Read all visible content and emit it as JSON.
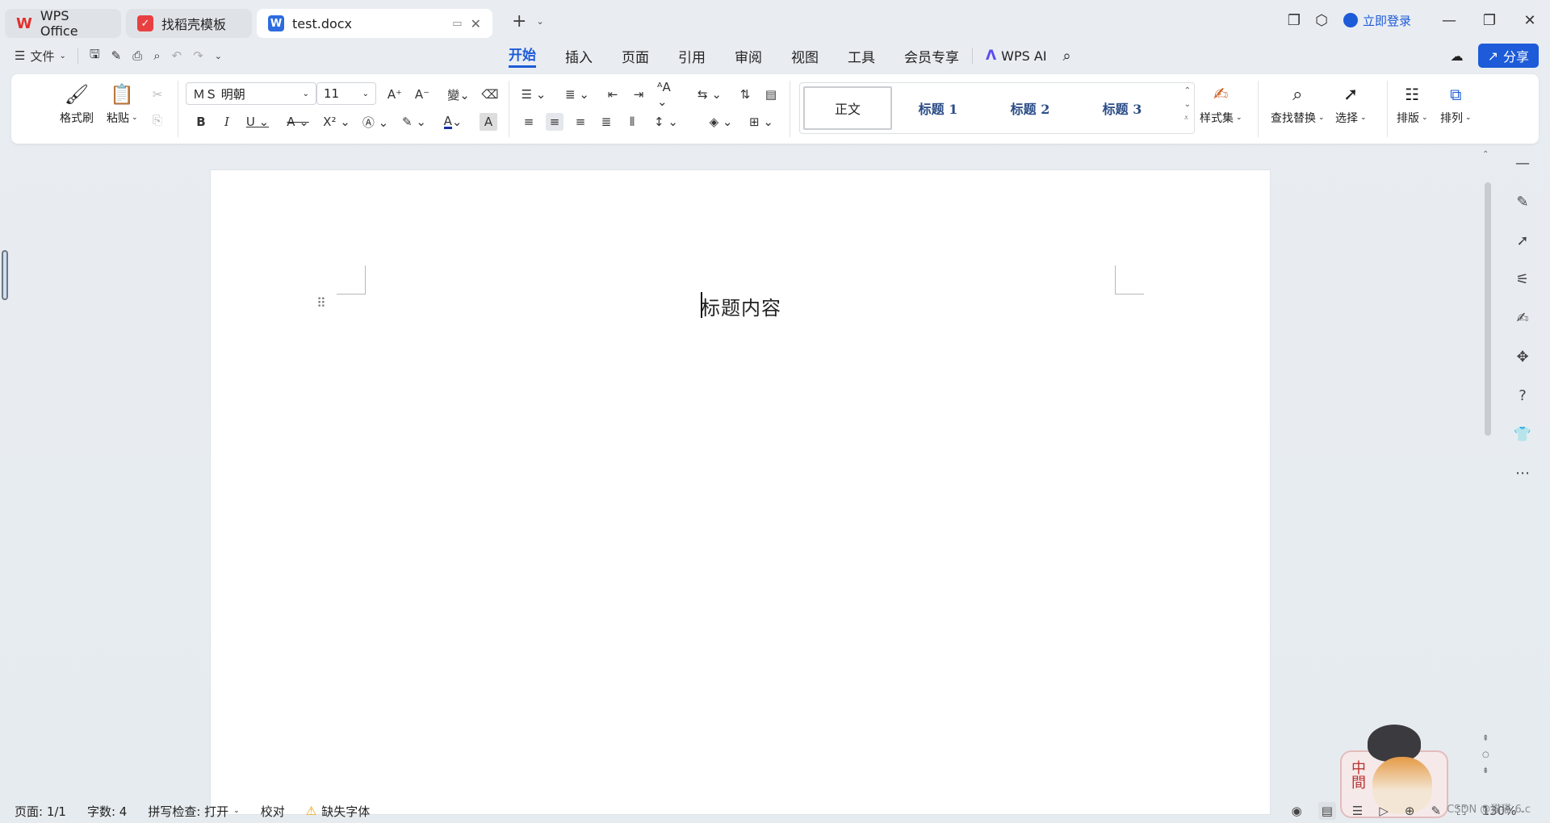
{
  "titlebar": {
    "tabs": [
      {
        "label": "WPS Office"
      },
      {
        "label": "找稻壳模板"
      },
      {
        "label": "test.docx"
      }
    ],
    "login_label": "立即登录"
  },
  "menubar": {
    "file_label": "文件",
    "tabs": [
      "开始",
      "插入",
      "页面",
      "引用",
      "审阅",
      "视图",
      "工具",
      "会员专享"
    ],
    "active_tab": "开始",
    "wps_ai_label": "WPS AI",
    "share_label": "分享"
  },
  "ribbon": {
    "format_painter_label": "格式刷",
    "paste_label": "粘贴",
    "font_name": "ＭＳ 明朝",
    "font_size": "11",
    "styles": {
      "normal": "正文",
      "h1": "标题 1",
      "h2": "标题 2",
      "h3": "标题 3"
    },
    "style_set_label": "样式集",
    "find_replace_label": "查找替换",
    "select_label": "选择",
    "layout_label": "排版",
    "arrange_label": "排列"
  },
  "document": {
    "content": "标题内容"
  },
  "statusbar": {
    "page": "页面: 1/1",
    "word_count": "字数: 4",
    "spell_check": "拼写检查: 打开",
    "proofread": "校对",
    "missing_font": "缺失字体",
    "zoom": "130%"
  },
  "sticker": {
    "text": "中間"
  },
  "watermark": "CSDN @猫猫.6.c",
  "colors": {
    "accent": "#1d5bd8",
    "wps_red": "#e0302b",
    "docer_red": "#e84040",
    "writer_blue": "#2d6cdf",
    "font_color_underline": "#1730a8"
  }
}
